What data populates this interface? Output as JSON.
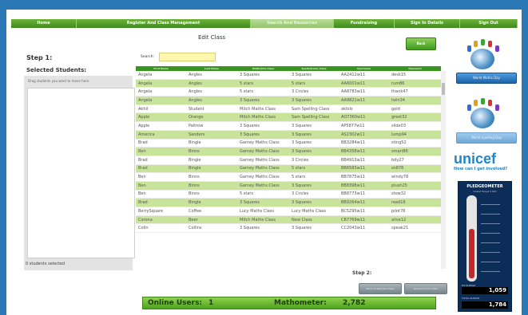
{
  "nav": {
    "items": [
      {
        "label": "Home"
      },
      {
        "label": "Register And Class Management"
      },
      {
        "label": "Search And Resources"
      },
      {
        "label": "Fundraising"
      },
      {
        "label": "Sign In Details"
      },
      {
        "label": "Sign Out"
      }
    ]
  },
  "page": {
    "title": "Edit Class",
    "back_label": "Back",
    "step1": "Step 1:",
    "selected_students": "Selected Students:",
    "drag_hint": "Drag students you want to move here.",
    "selected_count": "0 students selected",
    "search_label": "Search:",
    "search_value": "",
    "step2": "Step 2:",
    "move_button": "Move To Selected Class",
    "remove_button": "Remove From Class"
  },
  "table": {
    "headers": [
      "First Name",
      "Last Name",
      "Mathletics Class",
      "Spellodrome Class",
      "Username",
      "Password"
    ],
    "rows": [
      [
        "Angela",
        "Angles",
        "3 Squares",
        "3 Squares",
        "AA2412w11",
        "desk15"
      ],
      [
        "Angela",
        "Angles",
        "5 stars",
        "5 stars",
        "AA6001w11",
        "rum86"
      ],
      [
        "Angela",
        "Angles",
        "5 stars",
        "3 Circles",
        "AA8783w11",
        "thank47"
      ],
      [
        "Angela",
        "Angles",
        "3 Squares",
        "3 Squares",
        "AA9821w11",
        "twin34"
      ],
      [
        "Akhil",
        "Student",
        "Mitch Maths Class",
        "Sam Spelling Class",
        "akhils",
        "gold"
      ],
      [
        "Apple",
        "Orange",
        "Mitch Maths Class",
        "Sam Spelling Class",
        "AO7360w11",
        "greet32"
      ],
      [
        "Apple",
        "Paltrow",
        "3 Squares",
        "3 Squares",
        "AP5877w11",
        "slide03"
      ],
      [
        "America",
        "Sanders",
        "3 Squares",
        "3 Squares",
        "AS2302w11",
        "lump94"
      ],
      [
        "Brad",
        "Bingle",
        "Garney Maths Class",
        "3 Squares",
        "BB3284w11",
        "sting52"
      ],
      [
        "Ben",
        "Binns",
        "Garney Maths Class",
        "3 Squares",
        "BB4358w11",
        "smart86"
      ],
      [
        "Brad",
        "Bingle",
        "Garney Maths Class",
        "3 Circles",
        "BB4913w11",
        "bdy27"
      ],
      [
        "Brad",
        "Bingle",
        "Garney Maths Class",
        "5 stars",
        "BB6583w11",
        "sn876"
      ],
      [
        "Ben",
        "Binns",
        "Garney Maths Class",
        "5 stars",
        "BB7875w11",
        "windy78"
      ],
      [
        "Ben",
        "Binns",
        "Garney Maths Class",
        "3 Squares",
        "BB8398w11",
        "plush25"
      ],
      [
        "Ben",
        "Binns",
        "5 stars",
        "3 Circles",
        "BB8773w11",
        "stow32"
      ],
      [
        "Brad",
        "Bingle",
        "3 Squares",
        "3 Squares",
        "BB9264w11",
        "read16"
      ],
      [
        "BerrySquare",
        "Coffee",
        "Lucy Maths Class",
        "Lucy Maths Class",
        "BC5295w11",
        "pilot78"
      ],
      [
        "Corona",
        "Beer",
        "Mitch Maths Class",
        "New Class",
        "CB7769w11",
        "alive12"
      ],
      [
        "Colin",
        "Collins",
        "3 Squares",
        "3 Squares",
        "CC2043w11",
        "speak21"
      ]
    ]
  },
  "status": {
    "online_label": "Online Users:",
    "online_value": "1",
    "mathometer_label": "Mathometer:",
    "mathometer_value": "2,782"
  },
  "sidebar": {
    "world_button": "World Maths Day",
    "world_button2": "World Spelling Day",
    "unicef_logo": "unicef",
    "unicef_sub": "How can I get involved?",
    "pledgeometer_title": "PLEDGEOMETER",
    "pledgeometer_sub": "Global Target $ 60k",
    "my_pledge_label": "MY PLEDGE",
    "my_pledge_value": "1,059",
    "total_pledge_label": "TOTAL PLEDGE",
    "total_pledge_value": "1,784",
    "thermometer_fill": 0.62
  }
}
